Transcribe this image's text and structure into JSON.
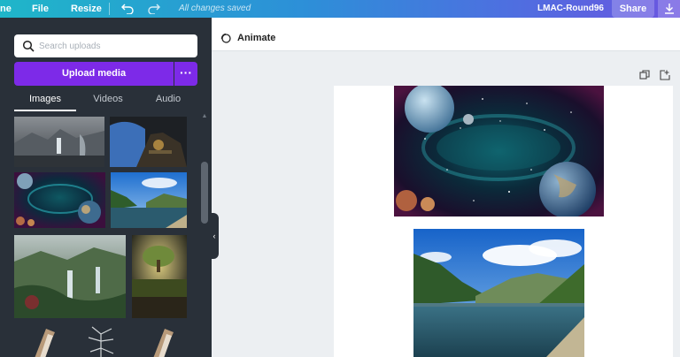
{
  "topbar": {
    "home_label": "ne",
    "file_label": "File",
    "resize_label": "Resize",
    "undo_icon": "undo-icon",
    "redo_icon": "redo-icon",
    "save_status": "All changes saved",
    "doc_title": "LMAC-Round96",
    "share_label": "Share",
    "download_icon": "download-icon"
  },
  "sidebar": {
    "search_placeholder": "Search uploads",
    "upload_label": "Upload media",
    "more_label": "···",
    "tabs": [
      {
        "label": "Images",
        "active": true
      },
      {
        "label": "Videos",
        "active": false
      },
      {
        "label": "Audio",
        "active": false
      }
    ],
    "collapse_icon": "‹"
  },
  "toolbar": {
    "animate_label": "Animate"
  },
  "colors": {
    "accent": "#7d2ae8",
    "sidebar_bg": "#293039",
    "canvas_bg": "#eceff2"
  }
}
